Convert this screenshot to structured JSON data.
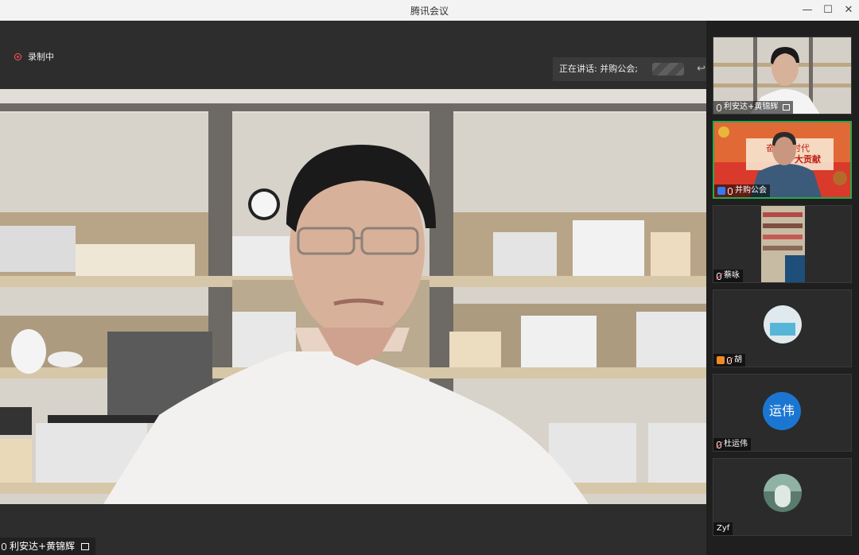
{
  "window": {
    "title": "腾讯会议",
    "minimize": "—",
    "maximize": "☐",
    "close": "✕"
  },
  "recording": {
    "label": "录制中"
  },
  "speaking": {
    "text": "正在讲话: 并购公会;",
    "back_icon": "reply-icon"
  },
  "main_speaker": {
    "name": "利安达+黄锦辉"
  },
  "participants": [
    {
      "name": "利安达+黄锦辉",
      "type": "video",
      "mic": "on"
    },
    {
      "name": "并购公会",
      "type": "video",
      "mic": "on",
      "active": true,
      "banner_line1": "奋进新时代",
      "banner_line2": "十大贡献"
    },
    {
      "name": "蔡咏",
      "type": "video",
      "mic": "off"
    },
    {
      "name": "胡",
      "type": "avatar",
      "mic": "off"
    },
    {
      "name": "杜运伟",
      "type": "initials",
      "initials": "运伟",
      "mic": "off",
      "color": "#1b76d2"
    },
    {
      "name": "Zyf",
      "type": "avatar",
      "mic": "none"
    }
  ]
}
